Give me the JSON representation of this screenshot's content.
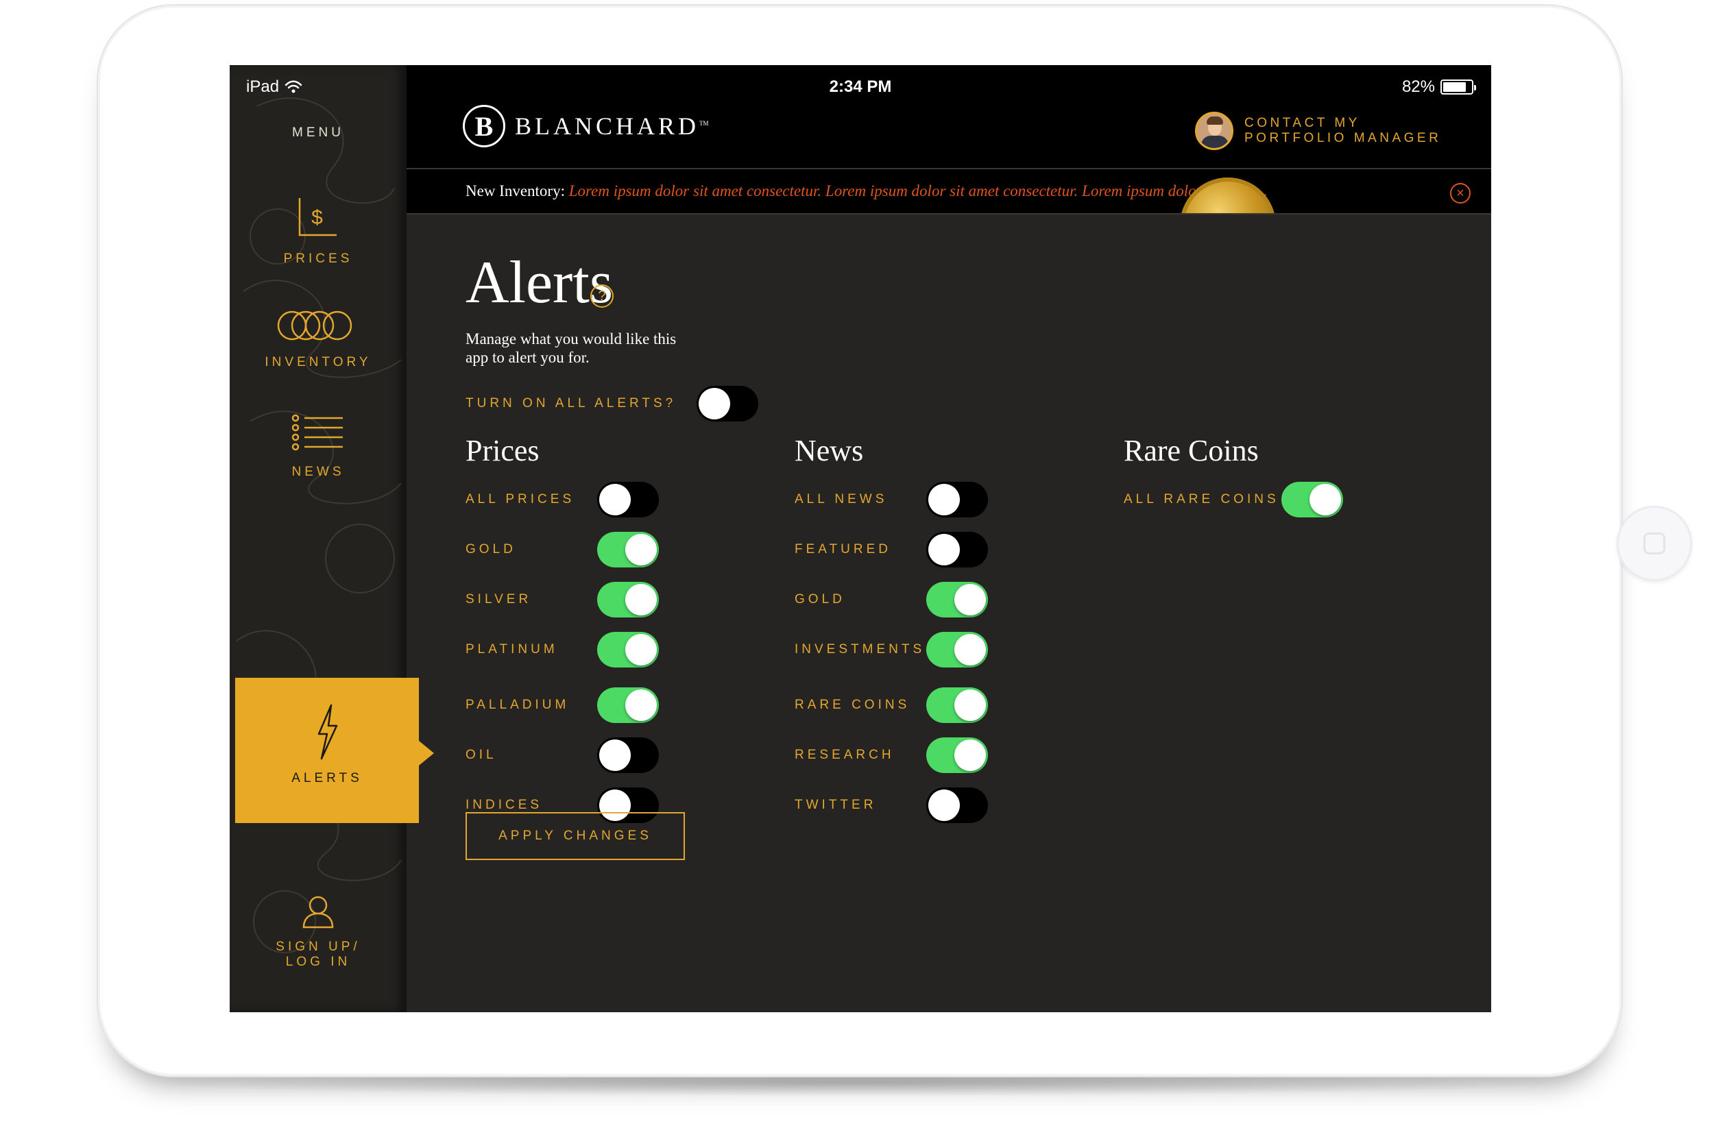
{
  "status_bar": {
    "device": "iPad",
    "time": "2:34 PM",
    "battery": "82%",
    "battery_level": 0.82
  },
  "sidebar": {
    "menu_label": "MENU",
    "items": [
      {
        "label": "PRICES",
        "icon": "dollar-chart-icon",
        "active": false
      },
      {
        "label": "INVENTORY",
        "icon": "coins-icon",
        "active": false
      },
      {
        "label": "NEWS",
        "icon": "list-icon",
        "active": false
      },
      {
        "label": "ALERTS",
        "icon": "lightning-icon",
        "active": true
      },
      {
        "label_line1": "SIGN UP/",
        "label_line2": "LOG IN",
        "icon": "user-icon",
        "active": false
      }
    ]
  },
  "header": {
    "logo_mark": "B",
    "logo_text": "BLANCHARD",
    "contact_label": "CONTACT MY PORTFOLIO MANAGER"
  },
  "ticker": {
    "prefix": "New Inventory:",
    "message": "Lorem ipsum dolor sit amet consectetur. Lorem ipsum dolor sit amet consectetur. Lorem ipsum dolor sit amet..."
  },
  "alerts": {
    "title": "Alerts",
    "help_symbol": "?",
    "description": "Manage what you would like this app to alert you for.",
    "all_alerts_label": "TURN ON ALL ALERTS?",
    "all_alerts_on": false,
    "columns": [
      {
        "title": "Prices",
        "rows": [
          {
            "label": "ALL PRICES",
            "on": false
          },
          {
            "label": "GOLD",
            "on": true
          },
          {
            "label": "SILVER",
            "on": true
          },
          {
            "label": "PLATINUM",
            "on": true
          },
          {
            "label": "PALLADIUM",
            "on": true
          },
          {
            "label": "OIL",
            "on": false
          },
          {
            "label": "INDICES",
            "on": false
          }
        ]
      },
      {
        "title": "News",
        "rows": [
          {
            "label": "ALL NEWS",
            "on": false
          },
          {
            "label": "FEATURED",
            "on": false
          },
          {
            "label": "GOLD",
            "on": true
          },
          {
            "label": "INVESTMENTS",
            "on": true
          },
          {
            "label": "RARE COINS",
            "on": true
          },
          {
            "label": "RESEARCH",
            "on": true
          },
          {
            "label": "TWITTER",
            "on": false
          }
        ]
      },
      {
        "title": "Rare Coins",
        "rows": [
          {
            "label": "ALL RARE COINS",
            "on": true
          }
        ]
      }
    ],
    "apply_label": "APPLY CHANGES"
  },
  "colors": {
    "accent": "#e3a72f",
    "toggle_on": "#4cd964",
    "ticker_text": "#e0541f",
    "background": "#262422"
  }
}
